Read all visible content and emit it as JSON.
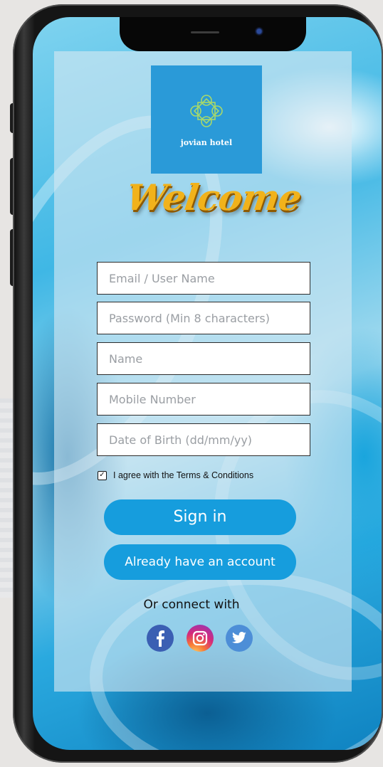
{
  "brand": {
    "name": "jovian hotel",
    "accent_color": "#2a9ad8",
    "button_color": "#169ddd",
    "welcome_color": "#f1b21b"
  },
  "welcome_title": "Welcome",
  "form": {
    "email_placeholder": "Email / User Name",
    "password_placeholder": "Password (Min 8 characters)",
    "name_placeholder": "Name",
    "mobile_placeholder": "Mobile Number",
    "dob_placeholder": "Date of Birth (dd/mm/yy)"
  },
  "terms": {
    "checked": true,
    "label": "I agree with the Terms & Conditions"
  },
  "buttons": {
    "sign_in": "Sign in",
    "already_account": "Already have an account"
  },
  "social": {
    "heading": "Or connect with",
    "icons": [
      "facebook-icon",
      "instagram-icon",
      "twitter-icon"
    ]
  }
}
